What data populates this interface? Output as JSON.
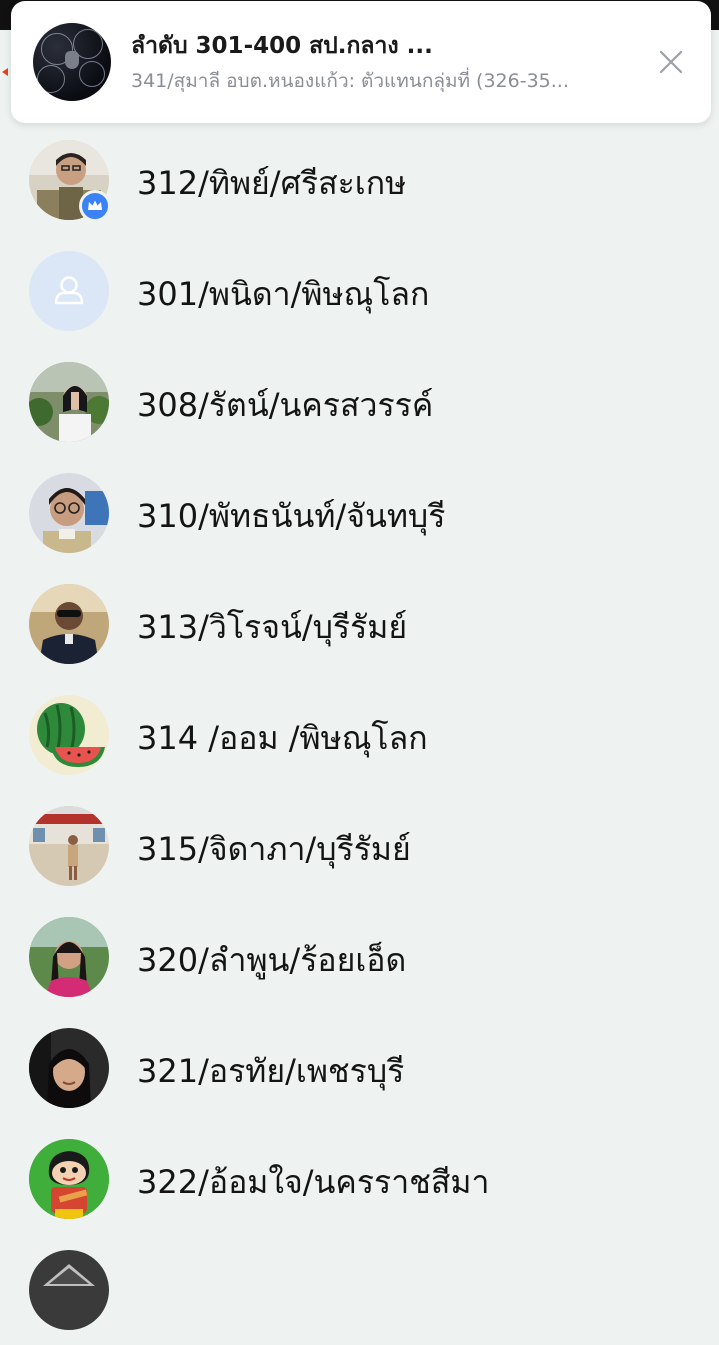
{
  "notification": {
    "title": "ลำดับ 301-400 สป.กลาง ...",
    "body": "341/สุมาลี อบต.หนองแก้ว: ตัวแทนกลุ่มที่ (326-35...",
    "avatar_icon": "group-avatar-icon",
    "close_icon": "close-icon"
  },
  "members": [
    {
      "name": "312/ทิพย์/ศรีสะเกษ",
      "avatar": "photo",
      "admin_badge": "crown-icon"
    },
    {
      "name": "301/พนิดา/พิษณุโลก",
      "avatar": "default-user-icon"
    },
    {
      "name": "308/รัตน์/นครสวรรค์",
      "avatar": "photo"
    },
    {
      "name": "310/พัทธนันท์/จันทบุรี",
      "avatar": "photo"
    },
    {
      "name": "313/วิโรจน์/บุรีรัมย์",
      "avatar": "photo"
    },
    {
      "name": "314 /ออม /พิษณุโลก",
      "avatar": "watermelon-icon"
    },
    {
      "name": "315/จิดาภา/บุรีรัมย์",
      "avatar": "photo"
    },
    {
      "name": "320/ลำพูน/ร้อยเอ็ด",
      "avatar": "photo"
    },
    {
      "name": "321/อรทัย/เพชรบุรี",
      "avatar": "photo"
    },
    {
      "name": "322/อ้อมใจ/นครราชสีมา",
      "avatar": "cartoon-icon"
    }
  ],
  "colors": {
    "background": "#eef3f1",
    "badge": "#3b82f6",
    "accent": "#e8421e"
  }
}
